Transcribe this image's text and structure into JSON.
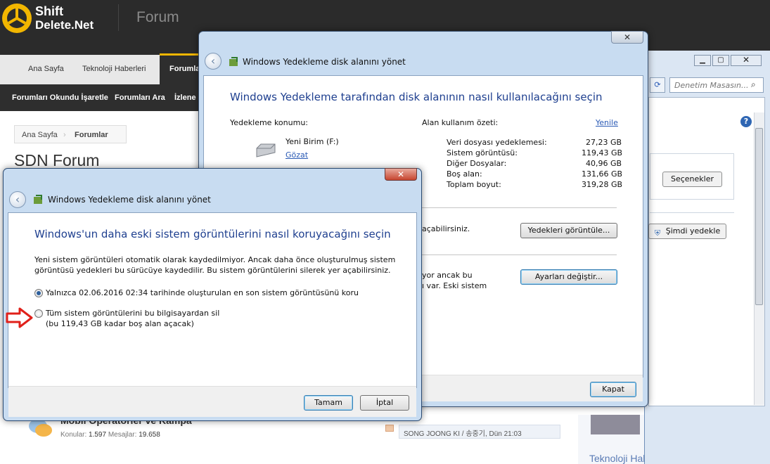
{
  "site": {
    "logo_line1": "Shift",
    "logo_line2": "Delete.Net",
    "title": "Forum",
    "tabs": [
      "Ana Sayfa",
      "Teknoloji Haberleri",
      "Forumla"
    ],
    "subnav": [
      "Forumları Okundu İşaretle",
      "Forumları Ara",
      "İzlene"
    ],
    "breadcrumb": [
      "Ana Sayfa",
      "Forumlar"
    ],
    "page_title": "SDN Forum",
    "forum_row_title": "Mobil Operatörler ve Kampa",
    "stats_konular_label": "Konular:",
    "stats_konular": "1.597",
    "stats_mesajlar_label": "Mesajlar:",
    "stats_mesajlar": "19.658",
    "last_post": "SONG JOONG KI / 송중기, Dün 21:03",
    "sidebar_heading": "Teknoloji Haberleri"
  },
  "control_panel": {
    "search_placeholder": "Denetim Masasın...",
    "options_button": "Seçenekler",
    "backup_now_button": "Şimdi yedekle"
  },
  "dialog_back": {
    "title": "Windows Yedekleme disk alanını yönet",
    "heading": "Windows Yedekleme tarafından disk alanının nasıl kullanılacağını seçin",
    "location_label": "Yedekleme konumu:",
    "drive_name": "Yeni Birim (F:)",
    "browse_link": "Gözat",
    "summary_label": "Alan kullanım özeti:",
    "refresh_link": "Yenile",
    "rows": [
      {
        "label": "Veri dosyası yedeklemesi:",
        "value": "27,23 GB"
      },
      {
        "label": "Sistem görüntüsü:",
        "value": "119,43 GB"
      },
      {
        "label": "Diğer Dosyalar:",
        "value": "40,96 GB"
      },
      {
        "label": "Boş alan:",
        "value": "131,66 GB"
      },
      {
        "label": "Toplam boyut:",
        "value": "319,28 GB"
      }
    ],
    "section1_text": "açabilirsiniz.",
    "view_backups_button": "Yedekleri görüntüle...",
    "section2_text1": "yor ancak bu",
    "section2_text2": "ı var. Eski sistem",
    "change_settings_button": "Ayarları değiştir...",
    "close_button": "Kapat"
  },
  "dialog_front": {
    "title": "Windows Yedekleme disk alanını yönet",
    "heading": "Windows'un daha eski sistem görüntülerini nasıl koruyacağını seçin",
    "description_line1": "Yeni sistem görüntüleri otomatik olarak kaydedilmiyor. Ancak daha önce oluşturulmuş sistem",
    "description_line2": "görüntüsü yedekleri bu sürücüye kaydedilir. Bu sistem görüntülerini silerek yer açabilirsiniz.",
    "option1": "Yalnızca 02.06.2016 02:34 tarihinde oluşturulan en son sistem görüntüsünü koru",
    "option2_line1": "Tüm sistem görüntülerini bu bilgisayardan sil",
    "option2_line2": "(bu 119,43 GB kadar boş alan açacak)",
    "ok_button": "Tamam",
    "cancel_button": "İptal"
  },
  "colors": {
    "accent_red_arrow": "#e0201a",
    "heading_blue": "#1e3f8f",
    "logo_yellow": "#f2b600"
  }
}
